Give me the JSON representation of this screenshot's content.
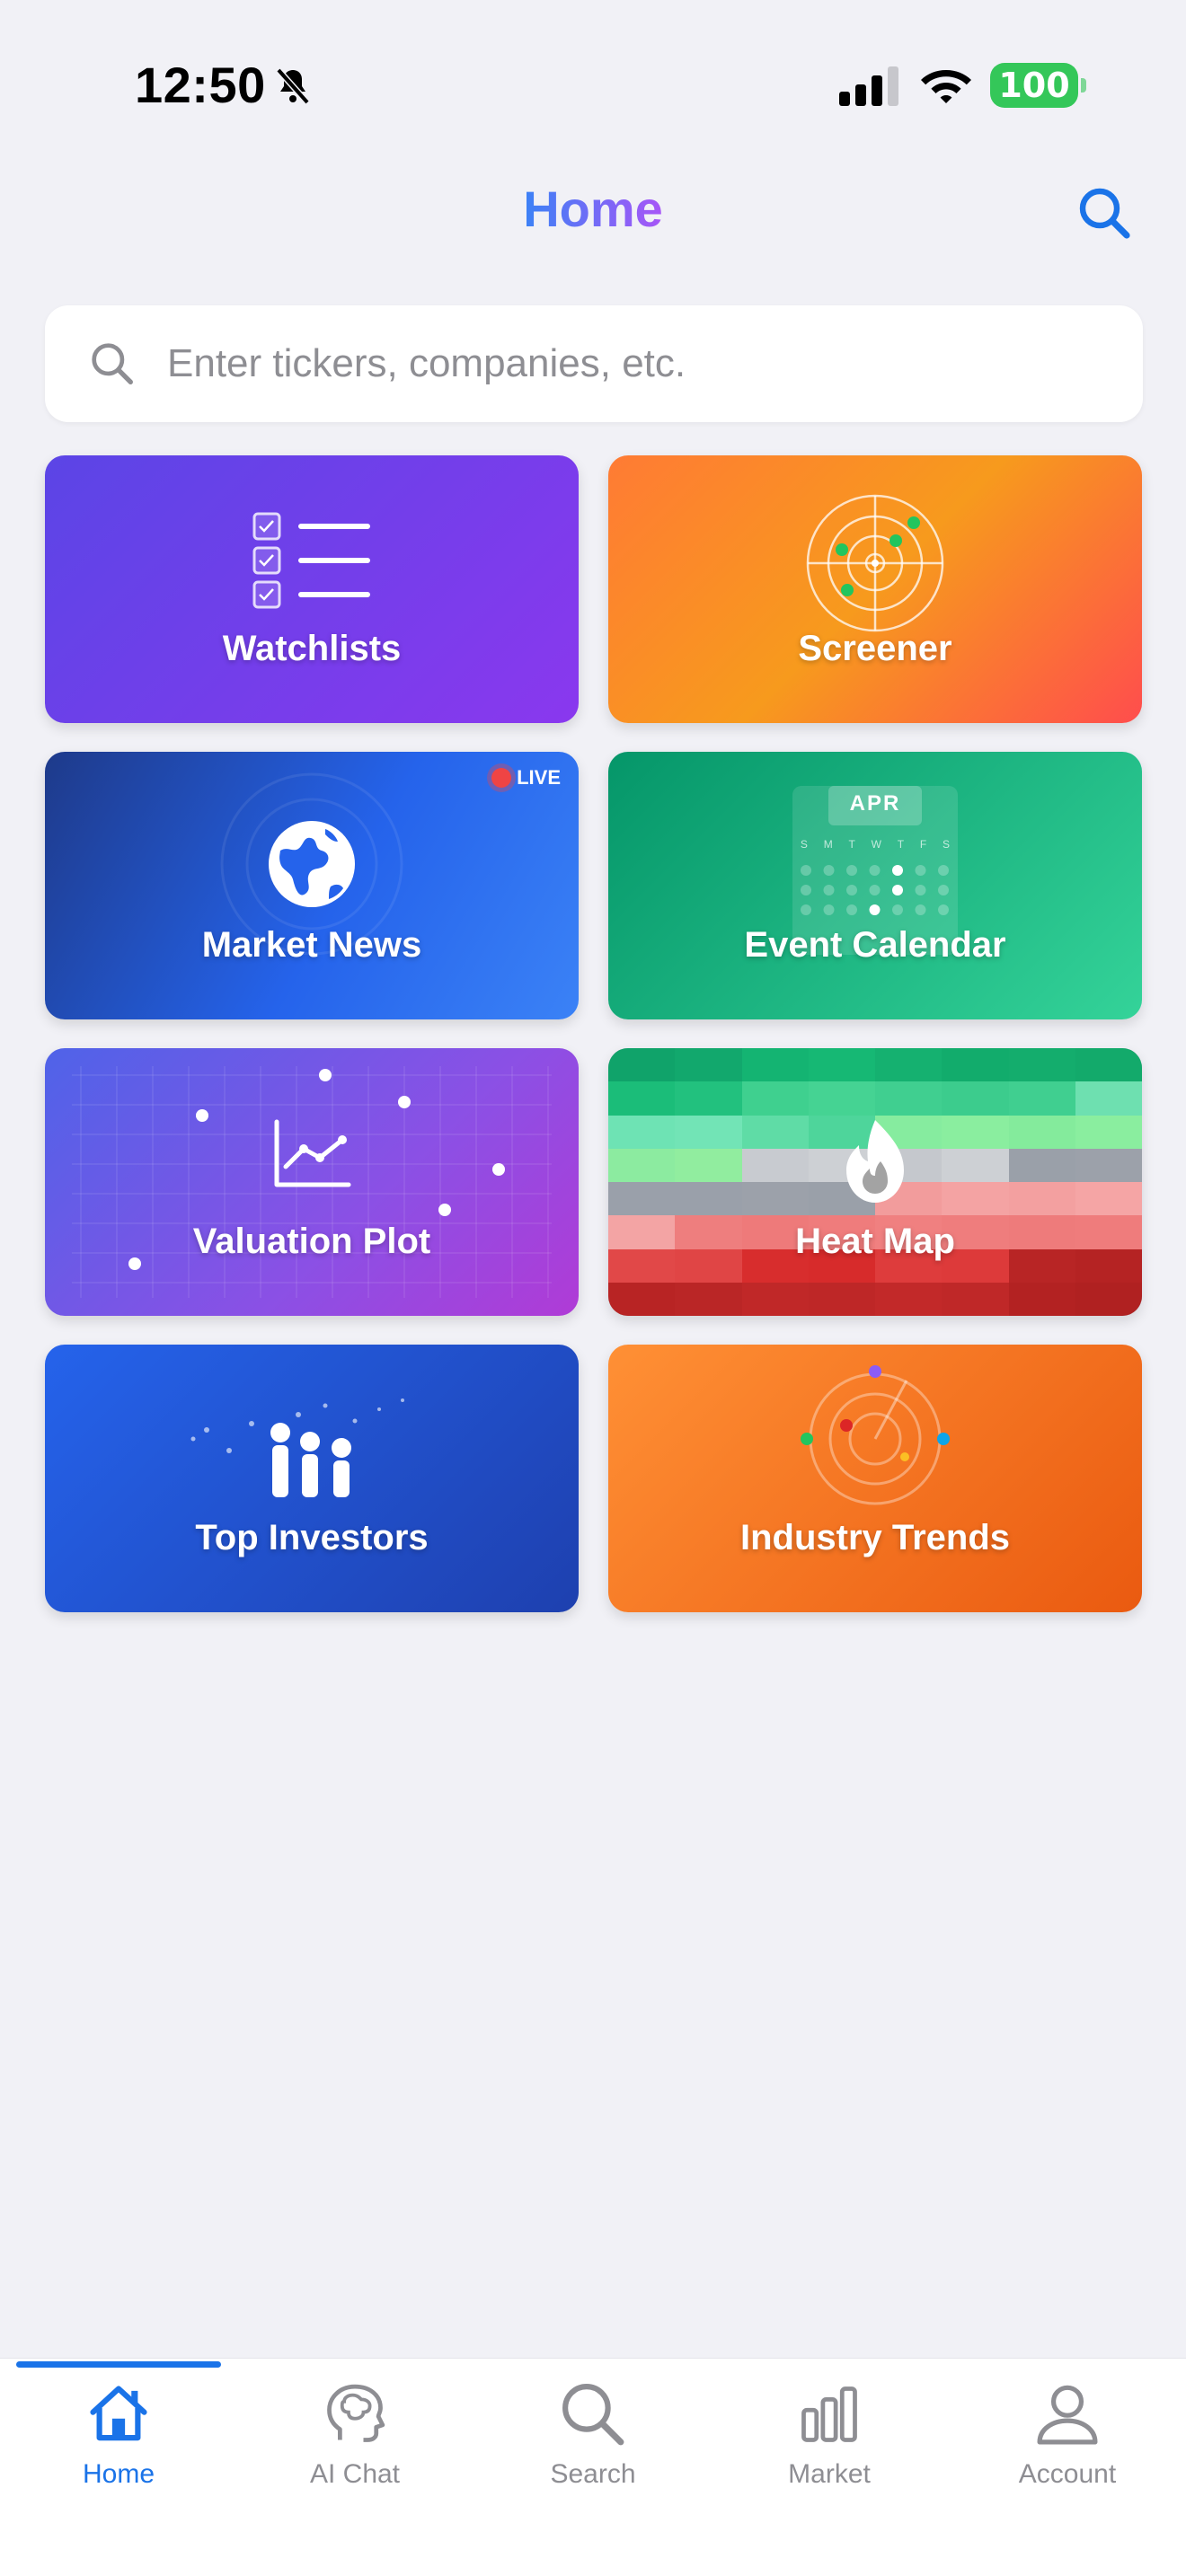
{
  "status_bar": {
    "time": "12:50",
    "battery": "100"
  },
  "header": {
    "title": "Home"
  },
  "search": {
    "placeholder": "Enter tickers, companies, etc."
  },
  "cards": [
    {
      "label": "Watchlists"
    },
    {
      "label": "Screener"
    },
    {
      "label": "Market News",
      "badge": "LIVE"
    },
    {
      "label": "Event Calendar",
      "month": "APR",
      "weekdays": [
        "S",
        "M",
        "T",
        "W",
        "T",
        "F",
        "S"
      ]
    },
    {
      "label": "Valuation Plot"
    },
    {
      "label": "Heat Map"
    },
    {
      "label": "Top Investors"
    },
    {
      "label": "Industry Trends"
    }
  ],
  "tabs": [
    {
      "label": "Home",
      "icon": "home-icon",
      "active": true
    },
    {
      "label": "AI Chat",
      "icon": "brain-head-icon"
    },
    {
      "label": "Search",
      "icon": "search-icon"
    },
    {
      "label": "Market",
      "icon": "bar-chart-icon"
    },
    {
      "label": "Account",
      "icon": "person-icon"
    }
  ],
  "colors": {
    "accent": "#1a73e8",
    "background": "#f1f1f6",
    "title_gradient": [
      "#3b82f6",
      "#a855f7"
    ],
    "live_dot": "#ef4444"
  }
}
